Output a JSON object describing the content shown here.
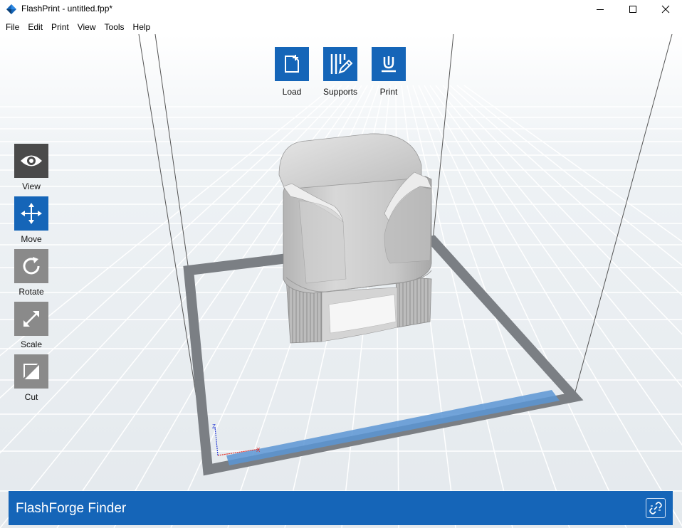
{
  "window": {
    "title": "FlashPrint - untitled.fpp*",
    "app_icon": "flashprint-diamond-icon"
  },
  "menu": [
    "File",
    "Edit",
    "Print",
    "View",
    "Tools",
    "Help"
  ],
  "top_toolbar": {
    "load": "Load",
    "supports": "Supports",
    "print": "Print"
  },
  "side_toolbar": {
    "view": "View",
    "move": "Move",
    "rotate": "Rotate",
    "scale": "Scale",
    "cut": "Cut",
    "active": "Move"
  },
  "axes": {
    "x": "X",
    "z": "Z"
  },
  "bottom_bar": {
    "printer_name": "FlashForge Finder"
  },
  "colors": {
    "accent": "#1565b8",
    "tool_inactive": "#8a8a8a",
    "tool_view": "#4a4a4a"
  }
}
